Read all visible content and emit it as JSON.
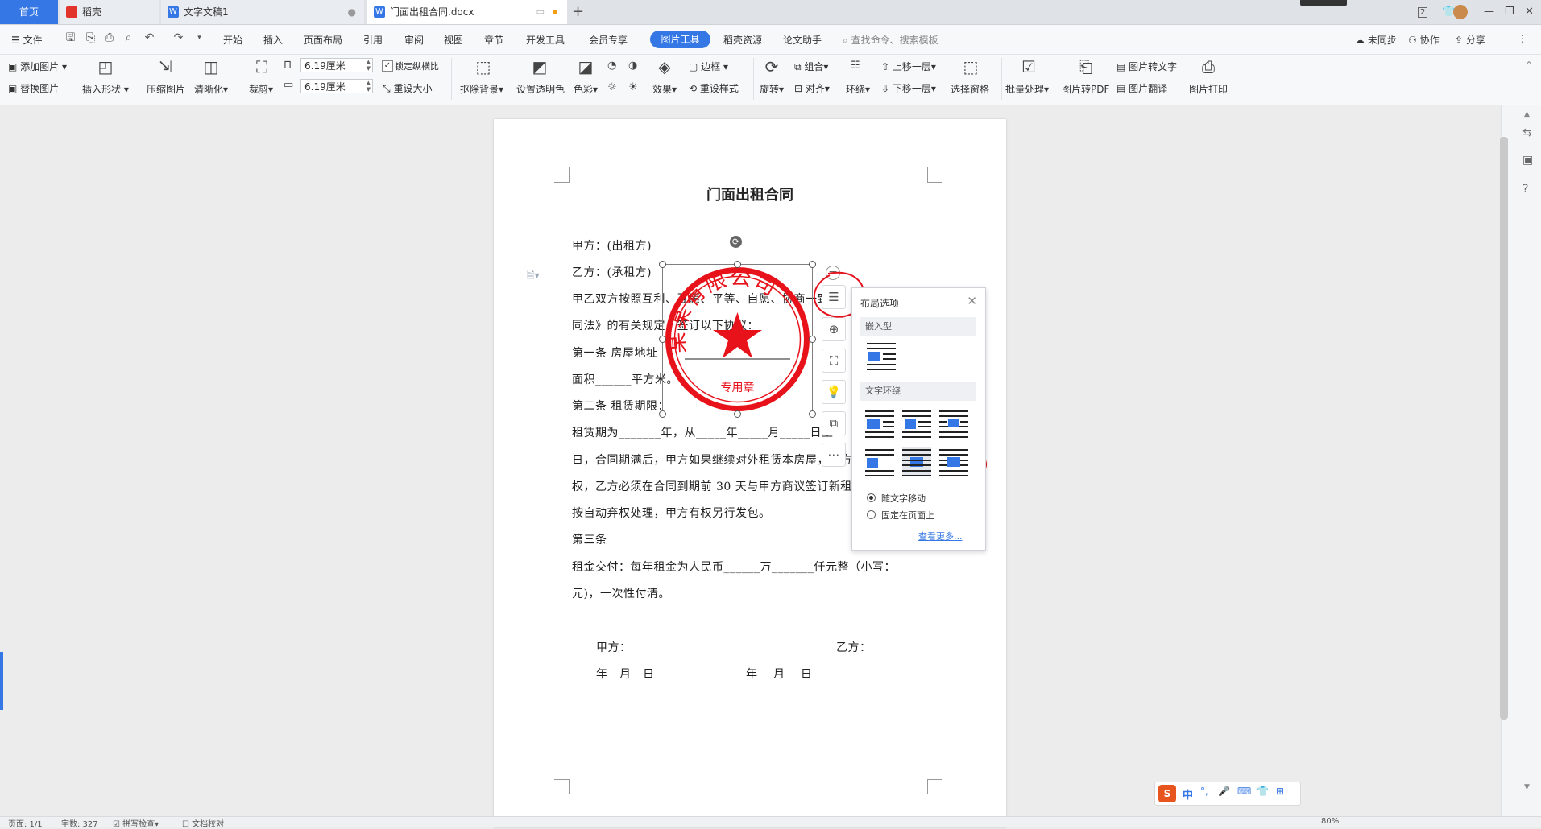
{
  "tabs": {
    "home": "首页",
    "daoke": "稻壳",
    "doc1": "文字文稿1",
    "doc2": "门面出租合同.docx",
    "new_tab": "+",
    "badge": "2"
  },
  "menu": {
    "file": "文件",
    "items": [
      "开始",
      "插入",
      "页面布局",
      "引用",
      "审阅",
      "视图",
      "章节",
      "开发工具",
      "会员专享"
    ],
    "picture_tools": "图片工具",
    "more": [
      "稻壳资源",
      "论文助手"
    ],
    "search_placeholder": "查找命令、搜索模板",
    "right": [
      "未同步",
      "协作",
      "分享"
    ]
  },
  "ribbon": {
    "add_picture": "添加图片",
    "replace_picture": "替换图片",
    "insert_shape": "插入形状",
    "compress": "压缩图片",
    "sharpen": "清晰化",
    "crop": "裁剪",
    "width": "6.19厘米",
    "height": "6.19厘米",
    "lock_ratio": "锁定纵横比",
    "reset_size": "重设大小",
    "remove_bg": "抠除背景",
    "set_transparent": "设置透明色",
    "color": "色彩",
    "effect": "效果",
    "border": "边框",
    "reset_style": "重设样式",
    "rotate": "旋转",
    "group": "组合",
    "align": "对齐",
    "wrap": "环绕",
    "bring_forward": "上移一层",
    "send_backward": "下移一层",
    "select_pane": "选择窗格",
    "batch": "批量处理",
    "to_pdf": "图片转PDF",
    "to_text": "图片转文字",
    "translate": "图片翻译",
    "print": "图片打印"
  },
  "document": {
    "title": "门面出租合同",
    "lines": [
      "甲方：(出租方)",
      "乙方：(承租方)",
      "甲乙双方按照互利、互惠、平等、自愿、协商一致原",
      "同法》的有关规定，签订以下协议：",
      "第一条 房屋地址",
      "面积______平方米。",
      "第二条 租赁期限：",
      "租赁期为_______年，从_____年_____月_____日至",
      "日，合同期满后，甲方如果继续对外租赁本房屋，乙方",
      "权，乙方必须在合同到期前 30 天与甲方商议签订新租",
      "按自动弃权处理，甲方有权另行发包。",
      "第三条",
      "租金交付：每年租金为人民币______万_______仟元整（小写：",
      "元)，一次性付清。"
    ],
    "sign_a": "甲方：",
    "sign_b": "乙方：",
    "date_a": "年　月　日",
    "date_b": "年　 月　 日"
  },
  "stamp": {
    "arc_text": "某某有限公司",
    "bottom_text": "专用章",
    "color": "#e8121b"
  },
  "layout_popup": {
    "title": "布局选项",
    "inline_section": "嵌入型",
    "wrap_section": "文字环绕",
    "move_with_text": "随文字移动",
    "fix_on_page": "固定在页面上",
    "see_more": "查看更多..."
  },
  "status": {
    "page": "页面: 1/1",
    "words": "字数: 327",
    "spell": "拼写检查",
    "proof": "文档校对",
    "zoom": "80%"
  },
  "ime": {
    "label": "中"
  },
  "colors": {
    "accent": "#3578e5",
    "annotation": "#e5101c"
  }
}
